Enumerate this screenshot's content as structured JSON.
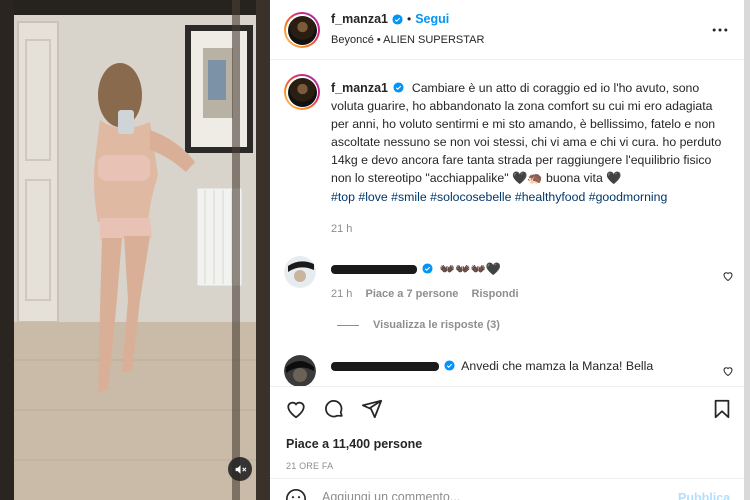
{
  "colors": {
    "accent": "#0095f6",
    "hashtag": "#00376b",
    "muted": "#8e8e8e",
    "text": "#262626"
  },
  "media": {
    "mute_icon": "speaker-muted-icon"
  },
  "header": {
    "username": "f_manza1",
    "dot": "•",
    "follow_label": "Segui",
    "music": "Beyoncé • ALIEN SUPERSTAR",
    "more_icon": "more-horizontal-icon"
  },
  "caption": {
    "username": "f_manza1",
    "text": "Cambiare è un atto di coraggio ed io l'ho avuto, sono voluta guarire, ho abbandonato la zona comfort su cui mi ero adagiata per anni, ho voluto sentirmi e mi sto amando, è bellissimo, fatelo e non ascoltate nessuno se non voi stessi, chi vi ama e chi vi cura. ho perduto 14kg e devo ancora fare tanta strada per raggiungere l'equilibrio fisico non lo stereotipo \"acchiappalike\" 🖤🦔 buona vita 🖤",
    "hashtags": "#top #love #smile #solocosebelle #healthyfood #goodmorning",
    "time": "21 h"
  },
  "comments": [
    {
      "text": "👐🏿👐🏿👐🏿🖤",
      "time": "21 h",
      "likes": "Piace a 7 persone",
      "reply": "Rispondi"
    },
    {
      "text": "Anvedi che mamza la Manza! Bella"
    }
  ],
  "replies_label": "Visualizza le risposte (3)",
  "actions": {
    "like_icon": "heart-icon",
    "comment_icon": "comment-icon",
    "share_icon": "send-icon",
    "save_icon": "bookmark-icon"
  },
  "likes": "Piace a 11,400 persone",
  "post_time": "21 ORE FA",
  "add_comment": {
    "emoji_icon": "emoji-icon",
    "placeholder": "Aggiungi un commento...",
    "publish_label": "Pubblica"
  }
}
